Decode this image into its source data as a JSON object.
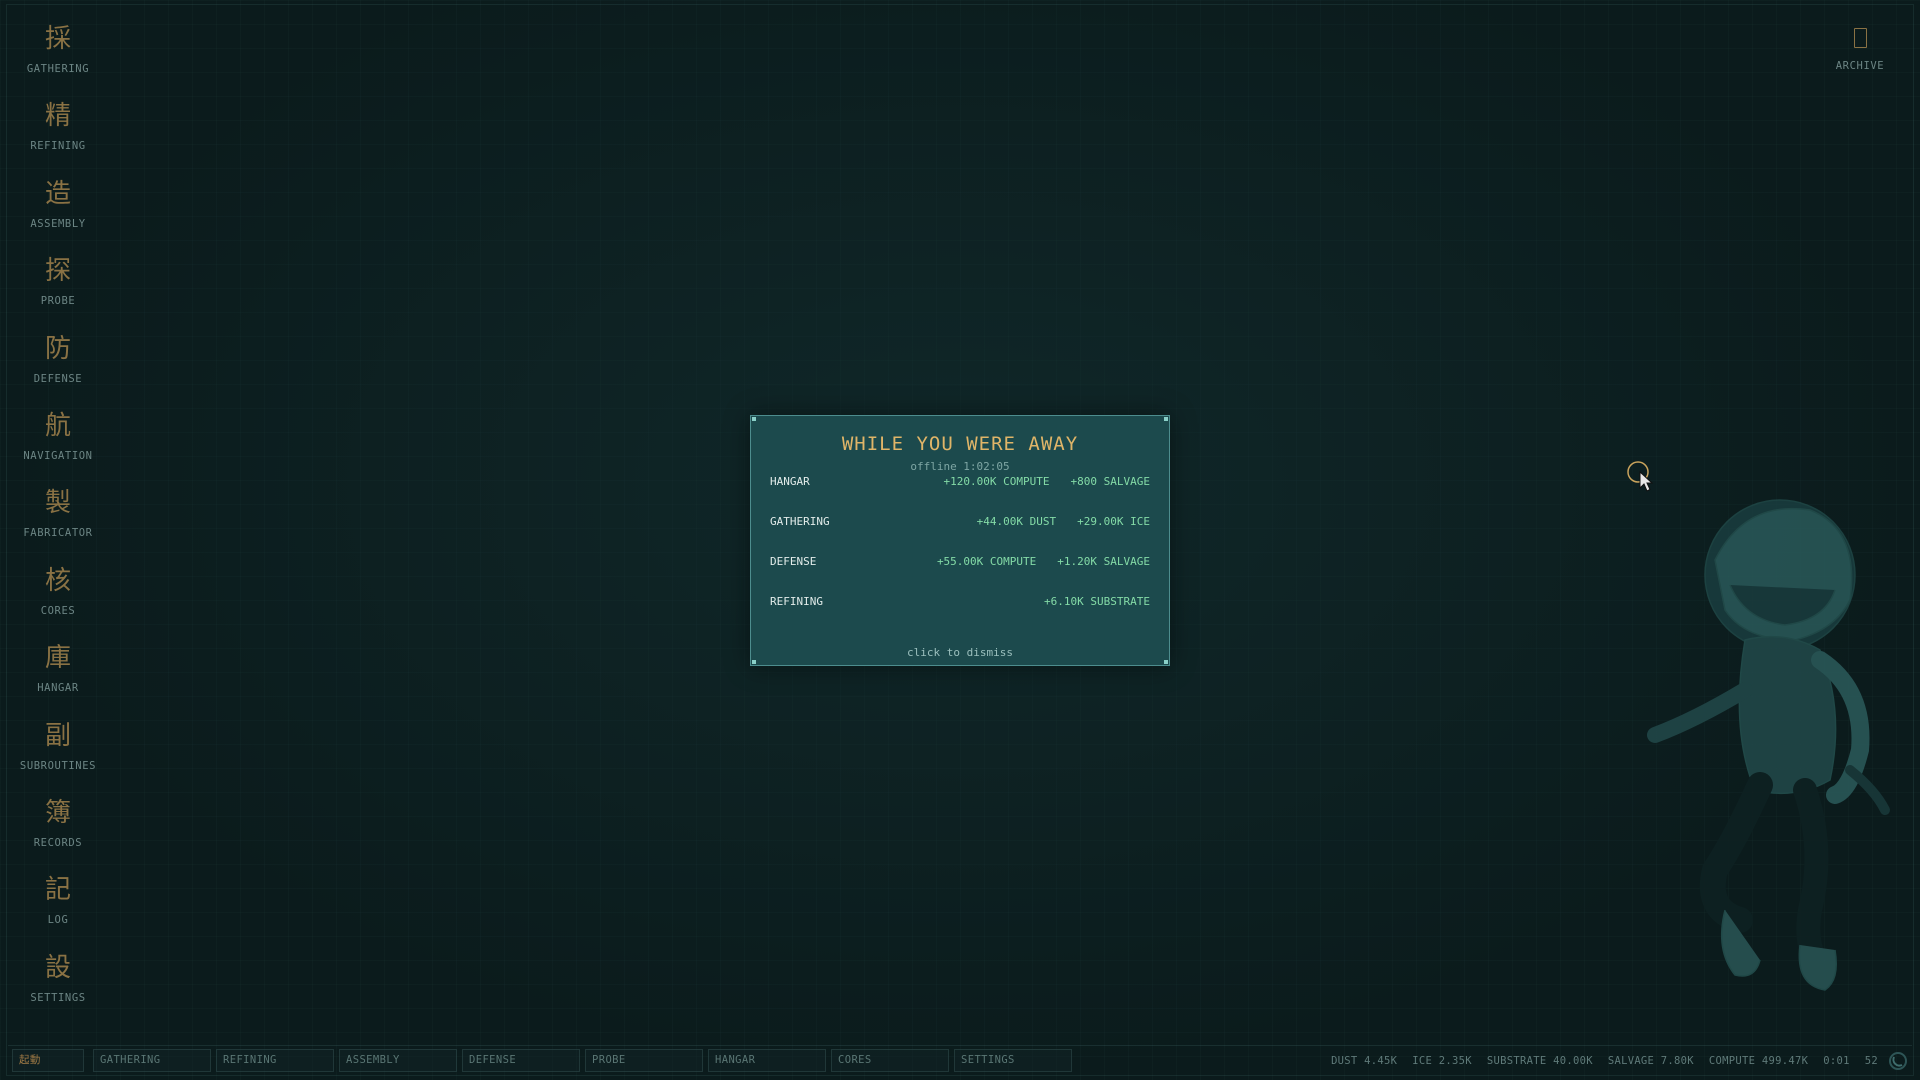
{
  "sidebar": {
    "items": [
      {
        "glyph": "採",
        "label": "GATHERING"
      },
      {
        "glyph": "精",
        "label": "REFINING"
      },
      {
        "glyph": "造",
        "label": "ASSEMBLY"
      },
      {
        "glyph": "探",
        "label": "PROBE"
      },
      {
        "glyph": "防",
        "label": "DEFENSE"
      },
      {
        "glyph": "航",
        "label": "NAVIGATION"
      },
      {
        "glyph": "製",
        "label": "FABRICATOR"
      },
      {
        "glyph": "核",
        "label": "CORES"
      },
      {
        "glyph": "庫",
        "label": "HANGAR"
      },
      {
        "glyph": "副",
        "label": "SUBROUTINES"
      },
      {
        "glyph": "簿",
        "label": "RECORDS"
      },
      {
        "glyph": "記",
        "label": "LOG"
      },
      {
        "glyph": "設",
        "label": "SETTINGS"
      }
    ]
  },
  "archive": {
    "label": "ARCHIVE",
    "icon": "archive-box-icon"
  },
  "dialog": {
    "title": "WHILE YOU WERE AWAY",
    "subtitle": "offline 1:02:05",
    "rows": [
      {
        "label": "HANGAR",
        "gains": [
          "+120.00K COMPUTE",
          "+800 SALVAGE"
        ]
      },
      {
        "label": "GATHERING",
        "gains": [
          "+44.00K DUST",
          "+29.00K ICE"
        ]
      },
      {
        "label": "DEFENSE",
        "gains": [
          "+55.00K COMPUTE",
          "+1.20K SALVAGE"
        ]
      },
      {
        "label": "REFINING",
        "gains": [
          "+6.10K SUBSTRATE"
        ]
      }
    ],
    "dismiss": "click to dismiss"
  },
  "bottombar": {
    "start": "起動",
    "tabs": [
      "GATHERING",
      "REFINING",
      "ASSEMBLY",
      "DEFENSE",
      "PROBE",
      "HANGAR",
      "CORES",
      "SETTINGS"
    ],
    "stats": {
      "dust": "DUST 4.45K",
      "ice": "ICE 2.35K",
      "substrate": "SUBSTRATE 40.00K",
      "salvage": "SALVAGE 7.80K",
      "compute": "COMPUTE 499.47K",
      "time": "0:01",
      "extra": "52"
    }
  },
  "colors": {
    "accent_gold": "#e0b568",
    "gain_green": "#84dba7",
    "dialog_bg": "#1c4a4d",
    "glyph": "#8a7244"
  }
}
